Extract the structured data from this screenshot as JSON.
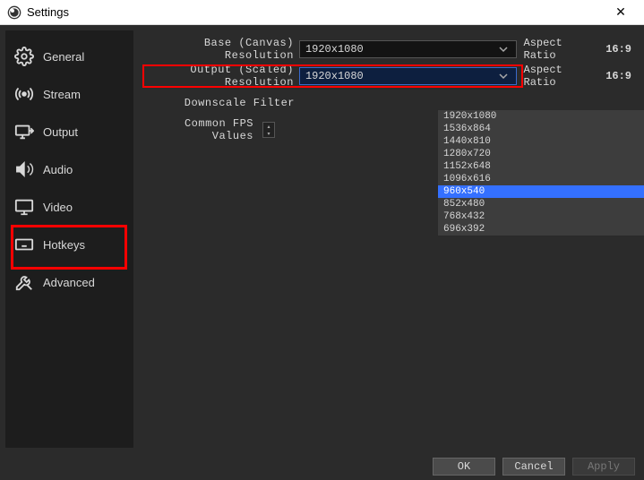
{
  "window": {
    "title": "Settings"
  },
  "sidebar": {
    "items": [
      {
        "label": "General"
      },
      {
        "label": "Stream"
      },
      {
        "label": "Output"
      },
      {
        "label": "Audio"
      },
      {
        "label": "Video"
      },
      {
        "label": "Hotkeys"
      },
      {
        "label": "Advanced"
      }
    ]
  },
  "video": {
    "base_label": "Base (Canvas) Resolution",
    "output_label": "Output (Scaled) Resolution",
    "filter_label": "Downscale Filter",
    "fps_label": "Common FPS Values",
    "aspect_label": "Aspect Ratio",
    "aspect_value": "16:9",
    "base_value": "1920x1080",
    "output_value": "1920x1080",
    "filter_value": "",
    "output_options": [
      "1920x1080",
      "1536x864",
      "1440x810",
      "1280x720",
      "1152x648",
      "1096x616",
      "960x540",
      "852x480",
      "768x432",
      "696x392"
    ],
    "output_selected": "960x540"
  },
  "buttons": {
    "ok": "OK",
    "cancel": "Cancel",
    "apply": "Apply"
  }
}
